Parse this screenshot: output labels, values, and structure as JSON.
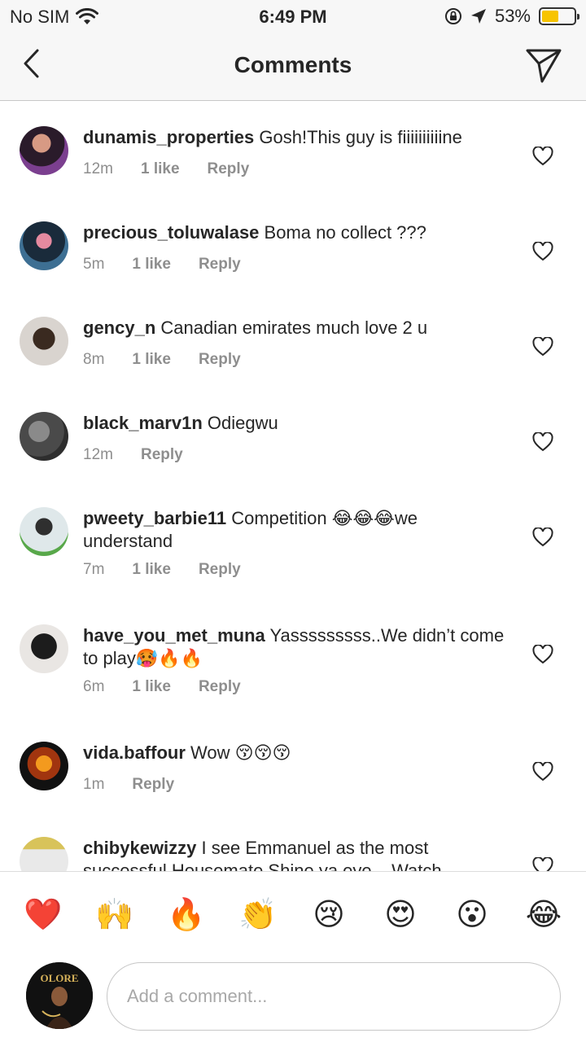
{
  "status_bar": {
    "carrier": "No SIM",
    "time": "6:49 PM",
    "battery_percent": "53%",
    "battery_level": 0.53,
    "icons": [
      "wifi-icon",
      "orientation-lock-icon",
      "location-arrow-icon",
      "battery-icon"
    ]
  },
  "header": {
    "title": "Comments",
    "back_icon": "chevron-left-icon",
    "send_icon": "paper-plane-icon"
  },
  "comments": [
    {
      "username": "dunamis_properties",
      "text": "Gosh!This guy is fiiiiiiiiiine",
      "time": "12m",
      "likes": "1 like",
      "reply": "Reply"
    },
    {
      "username": "precious_toluwalase",
      "text": "Boma no collect ???",
      "time": "5m",
      "likes": "1 like",
      "reply": "Reply"
    },
    {
      "username": "gency_n",
      "text": "Canadian emirates much love 2 u",
      "time": "8m",
      "likes": "1 like",
      "reply": "Reply"
    },
    {
      "username": "black_marv1n",
      "text": "Odiegwu",
      "time": "12m",
      "likes": "",
      "reply": "Reply"
    },
    {
      "username": "pweety_barbie11",
      "text": "Competition 😂😂😂we understand",
      "time": "7m",
      "likes": "1 like",
      "reply": "Reply"
    },
    {
      "username": "have_you_met_muna",
      "text": "Yasssssssss..We didn’t come to play🥵🔥🔥",
      "time": "6m",
      "likes": "1 like",
      "reply": "Reply"
    },
    {
      "username": "vida.baffour",
      "text": "Wow 😚😚😚",
      "time": "1m",
      "likes": "",
      "reply": "Reply"
    },
    {
      "username": "chibykewizzy",
      "text": "I see Emmanuel as the most successful Housemate Shine ya eye... Watch",
      "time": "",
      "likes": "",
      "reply": ""
    }
  ],
  "reactions": [
    "❤️",
    "🙌",
    "🔥",
    "👏",
    "😢",
    "😍",
    "😮",
    "😂"
  ],
  "composer": {
    "placeholder": "Add a comment...",
    "avatar_text": "OLORE"
  }
}
